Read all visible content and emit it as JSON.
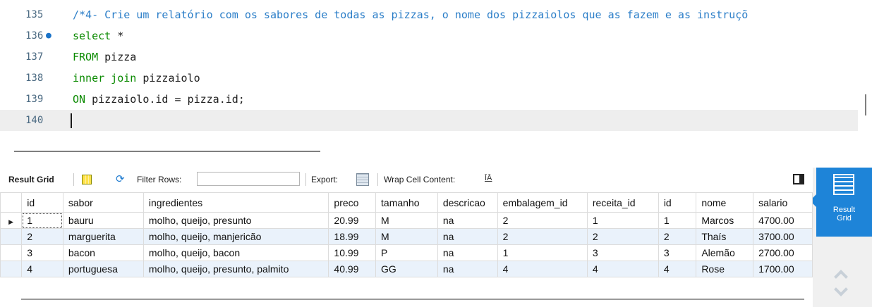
{
  "editor": {
    "lines": [
      {
        "num": "135",
        "tokens": [
          {
            "t": "/*4- Crie um relatório com os sabores de todas as pizzas, o nome dos pizzaiolos que as fazem e as instruçõ",
            "c": "cm"
          }
        ]
      },
      {
        "num": "136",
        "marker": "●",
        "tokens": [
          {
            "t": "select",
            "c": "kw"
          },
          {
            "t": " *",
            "c": ""
          }
        ]
      },
      {
        "num": "137",
        "tokens": [
          {
            "t": "FROM",
            "c": "kw"
          },
          {
            "t": " pizza",
            "c": ""
          }
        ]
      },
      {
        "num": "138",
        "tokens": [
          {
            "t": "inner join",
            "c": "kw"
          },
          {
            "t": " pizzaiolo",
            "c": ""
          }
        ]
      },
      {
        "num": "139",
        "tokens": [
          {
            "t": "ON",
            "c": "kw"
          },
          {
            "t": " pizzaiolo.id = pizza.id;",
            "c": ""
          }
        ]
      },
      {
        "num": "140",
        "tokens": [],
        "current": true
      }
    ]
  },
  "toolbar": {
    "result_grid_label": "Result Grid",
    "filter_rows_label": "Filter Rows:",
    "filter_value": "",
    "export_label": "Export:",
    "wrap_label": "Wrap Cell Content:",
    "wrap_icon": "ĪĀ"
  },
  "sidepanel": {
    "result_grid_line1": "Result",
    "result_grid_line2": "Grid"
  },
  "grid": {
    "columns": [
      "id",
      "sabor",
      "ingredientes",
      "preco",
      "tamanho",
      "descricao",
      "embalagem_id",
      "receita_id",
      "id",
      "nome",
      "salario"
    ],
    "rows": [
      [
        "1",
        "bauru",
        "molho, queijo, presunto",
        "20.99",
        "M",
        "na",
        "2",
        "1",
        "1",
        "Marcos",
        "4700.00"
      ],
      [
        "2",
        "marguerita",
        "molho, queijo, manjericão",
        "18.99",
        "M",
        "na",
        "2",
        "2",
        "2",
        "Thaís",
        "3700.00"
      ],
      [
        "3",
        "bacon",
        "molho, queijo, bacon",
        "10.99",
        "P",
        "na",
        "1",
        "3",
        "3",
        "Alemão",
        "2700.00"
      ],
      [
        "4",
        "portuguesa",
        "molho, queijo, presunto, palmito",
        "40.99",
        "GG",
        "na",
        "4",
        "4",
        "4",
        "Rose",
        "1700.00"
      ]
    ],
    "selected_row_marker": "▶"
  }
}
